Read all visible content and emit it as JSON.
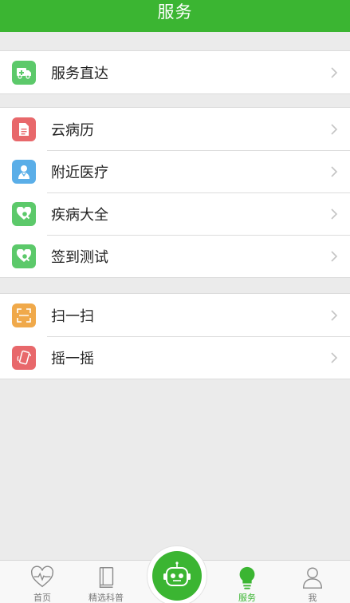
{
  "header": {
    "title": "服务"
  },
  "groups": [
    {
      "items": [
        {
          "label": "服务直达",
          "icon": "ambulance-icon",
          "color": "#5cc96a"
        }
      ]
    },
    {
      "items": [
        {
          "label": "云病历",
          "icon": "document-icon",
          "color": "#e8686b"
        },
        {
          "label": "附近医疗",
          "icon": "doctor-icon",
          "color": "#5aaee8"
        },
        {
          "label": "疾病大全",
          "icon": "heart-search-icon",
          "color": "#5cc96a"
        },
        {
          "label": "签到测试",
          "icon": "heart-search-icon",
          "color": "#5cc96a"
        }
      ]
    },
    {
      "items": [
        {
          "label": "扫一扫",
          "icon": "scan-icon",
          "color": "#f0a94a"
        },
        {
          "label": "摇一摇",
          "icon": "shake-phone-icon",
          "color": "#e8686b"
        }
      ]
    }
  ],
  "tabbar": {
    "tabs": [
      {
        "label": "首页",
        "icon": "heart-pulse-icon"
      },
      {
        "label": "精选科普",
        "icon": "book-icon"
      },
      {
        "label": "服务",
        "icon": "lightbulb-icon",
        "active": true
      },
      {
        "label": "我",
        "icon": "person-icon"
      }
    ],
    "center_icon": "robot-icon"
  },
  "colors": {
    "brand": "#3bb532",
    "background": "#ebebeb"
  }
}
